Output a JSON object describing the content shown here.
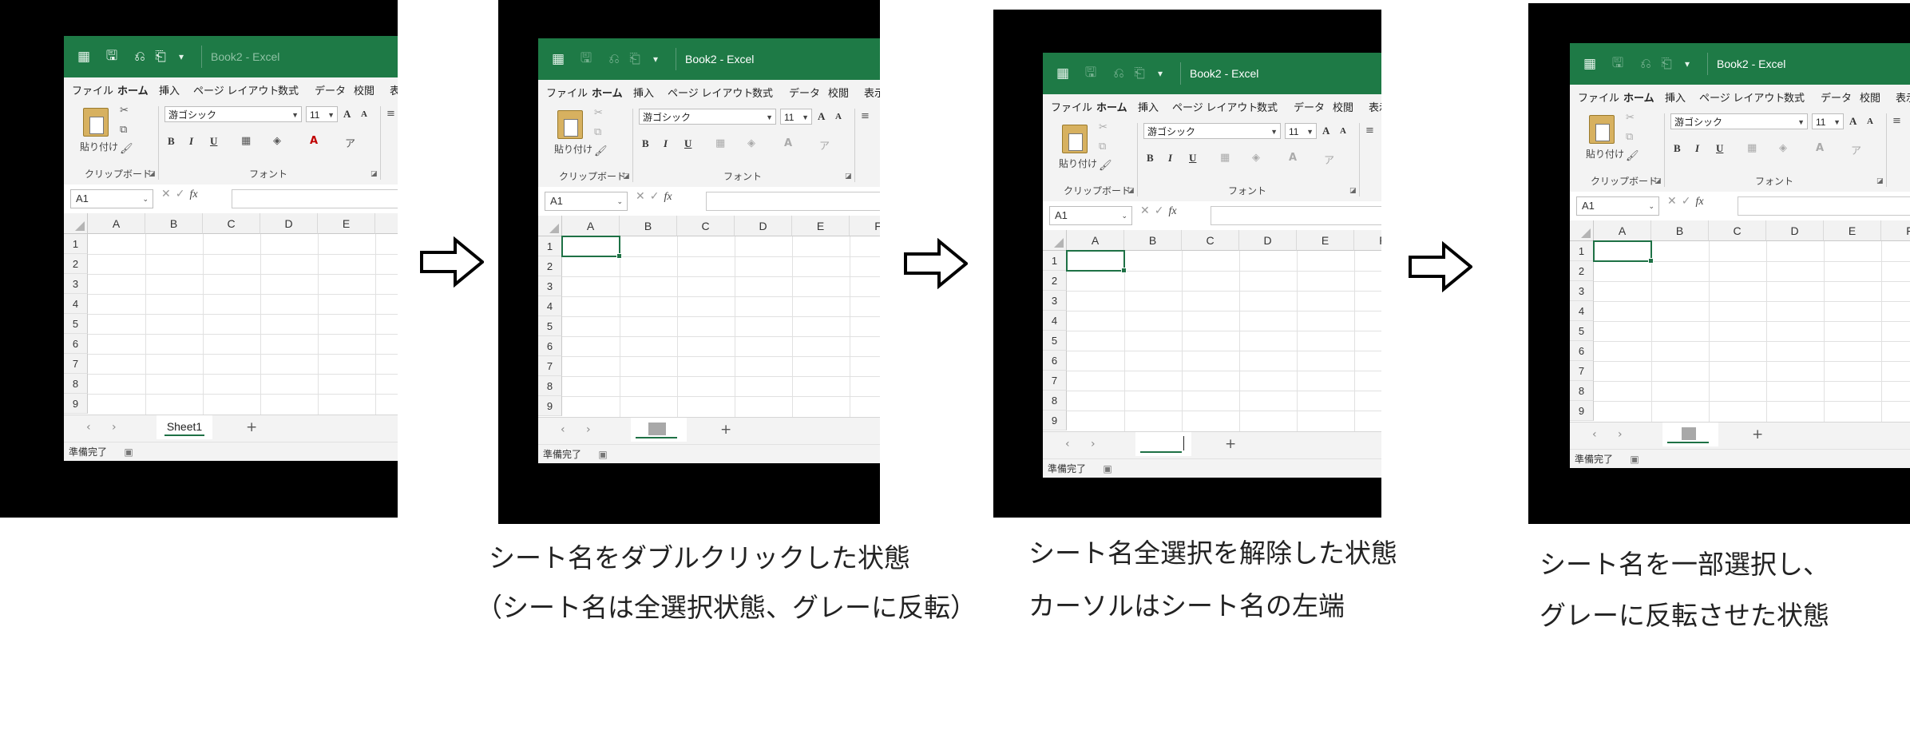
{
  "window": {
    "title": "Book2  -  Excel",
    "tabs": [
      "ファイル",
      "ホーム",
      "挿入",
      "ページ レイアウト",
      "数式",
      "データ",
      "校閲",
      "表示"
    ],
    "clipboard": {
      "paste_label": "貼り付け",
      "group_label": "クリップボード"
    },
    "font": {
      "name": "游ゴシック",
      "size": "11",
      "group_label": "フォント",
      "bold": "B",
      "italic": "I",
      "underline": "U",
      "grow": "A",
      "shrink": "A"
    },
    "namebox_value": "A1",
    "fx_label": "fx",
    "columns": [
      "A",
      "B",
      "C",
      "D",
      "E",
      "F"
    ],
    "rows": [
      "1",
      "2",
      "3",
      "4",
      "5",
      "6",
      "7",
      "8",
      "9"
    ],
    "add_sheet": "+",
    "status": "準備完了"
  },
  "panels": [
    {
      "state": "original",
      "sheet_name": "Sheet1",
      "caption": []
    },
    {
      "state": "double-clicked",
      "sheet_name": "",
      "caption": [
        "シート名をダブルクリックした状態",
        "（シート名は全選択状態、グレーに反転）"
      ]
    },
    {
      "state": "deselected",
      "sheet_name": "",
      "caption": [
        "シート名全選択を解除した状態",
        "カーソルはシート名の左端"
      ]
    },
    {
      "state": "partial-selection",
      "sheet_name": "",
      "caption": [
        "シート名を一部選択し、",
        "グレーに反転させた状態"
      ]
    }
  ],
  "colors": {
    "excel_green": "#1e7a46",
    "selection_grey": "#a8a8a8",
    "background": "#000000"
  },
  "icons": [
    "excel-app-icon",
    "save-icon",
    "undo-icon",
    "customize-icon",
    "paste-icon",
    "cut-icon",
    "copy-icon",
    "format-painter-icon",
    "right-arrow-icon"
  ]
}
